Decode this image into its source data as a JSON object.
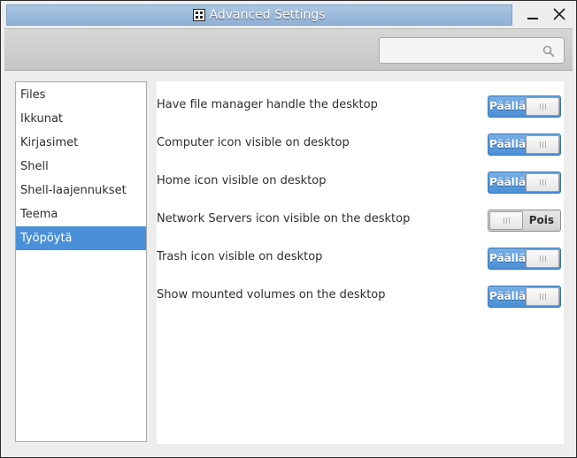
{
  "window": {
    "title": "Advanced Settings",
    "app_icon": "tweak-tool-icon"
  },
  "header": {
    "search_placeholder": "",
    "search_value": ""
  },
  "sidebar": {
    "items": [
      {
        "label": "Files",
        "selected": false
      },
      {
        "label": "Ikkunat",
        "selected": false
      },
      {
        "label": "Kirjasimet",
        "selected": false
      },
      {
        "label": "Shell",
        "selected": false
      },
      {
        "label": "Shell-laajennukset",
        "selected": false
      },
      {
        "label": "Teema",
        "selected": false
      },
      {
        "label": "Työpöytä",
        "selected": true
      }
    ]
  },
  "settings": [
    {
      "label": "Have file manager handle the desktop",
      "state": "on",
      "state_label": "Päällä"
    },
    {
      "label": "Computer icon visible on desktop",
      "state": "on",
      "state_label": "Päällä"
    },
    {
      "label": "Home icon visible on desktop",
      "state": "on",
      "state_label": "Päällä"
    },
    {
      "label": "Network Servers icon visible on the desktop",
      "state": "off",
      "state_label": "Pois"
    },
    {
      "label": "Trash icon visible on desktop",
      "state": "on",
      "state_label": "Päällä"
    },
    {
      "label": "Show mounted volumes on the desktop",
      "state": "on",
      "state_label": "Päällä"
    }
  ],
  "colors": {
    "accent": "#4a90d9",
    "switch_on": "#4a8fd6",
    "title_bar": "#8fb1d6"
  }
}
